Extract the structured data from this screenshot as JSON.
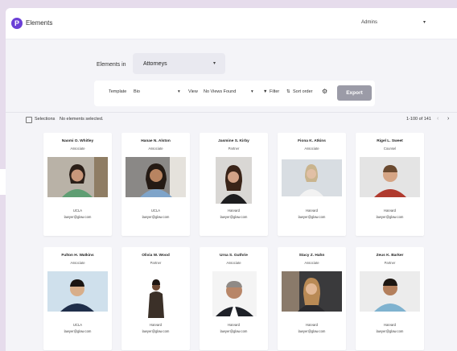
{
  "app": {
    "logo_letter": "P",
    "title": "Elements",
    "user": "Admins"
  },
  "filter": {
    "label": "Elements in",
    "value": "Attorneys"
  },
  "toolbar": {
    "template_label": "Template",
    "template_value": "Bio",
    "view_label": "View",
    "view_value": "No Views Found",
    "filter_label": "Filter",
    "sort_label": "Sort order",
    "export_label": "Export"
  },
  "selection": {
    "label": "Selections",
    "status": "No elements selected.",
    "pager": "1-100 of 141"
  },
  "cards": [
    {
      "name": "Naomi O. Whitley",
      "title": "Associate",
      "school": "UCLA",
      "email": "lawyer@glaw.com"
    },
    {
      "name": "Hanae N. Alston",
      "title": "Associate",
      "school": "UCLA",
      "email": "lawyer@glaw.com"
    },
    {
      "name": "Jasmine S. Kirby",
      "title": "Partner",
      "school": "Harvard",
      "email": "lawyer@glaw.com"
    },
    {
      "name": "Fiona K. Atkins",
      "title": "Associate",
      "school": "Harvard",
      "email": "lawyer@glaw.com"
    },
    {
      "name": "Rigel L. Sweet",
      "title": "Counsel",
      "school": "Harvard",
      "email": "lawyer@glaw.com"
    },
    {
      "name": "Fulton H. Watkins",
      "title": "Associate",
      "school": "UCLA",
      "email": "lawyer@glaw.com"
    },
    {
      "name": "Olivia W. Wood",
      "title": "Partner",
      "school": "Harvard",
      "email": "lawyer@glaw.com"
    },
    {
      "name": "Ursa S. Guthrie",
      "title": "Associate",
      "school": "Harvard",
      "email": "lawyer@glaw.com"
    },
    {
      "name": "Stacy Z. Hahn",
      "title": "Associate",
      "school": "Harvard",
      "email": "lawyer@glaw.com"
    },
    {
      "name": "Zeus K. Barker",
      "title": "Partner",
      "school": "Harvard",
      "email": "lawyer@glaw.com"
    }
  ],
  "colors": {
    "accent": "#6b3fd6",
    "export_button": "#9b9ba7",
    "background": "#f4f4f8"
  }
}
